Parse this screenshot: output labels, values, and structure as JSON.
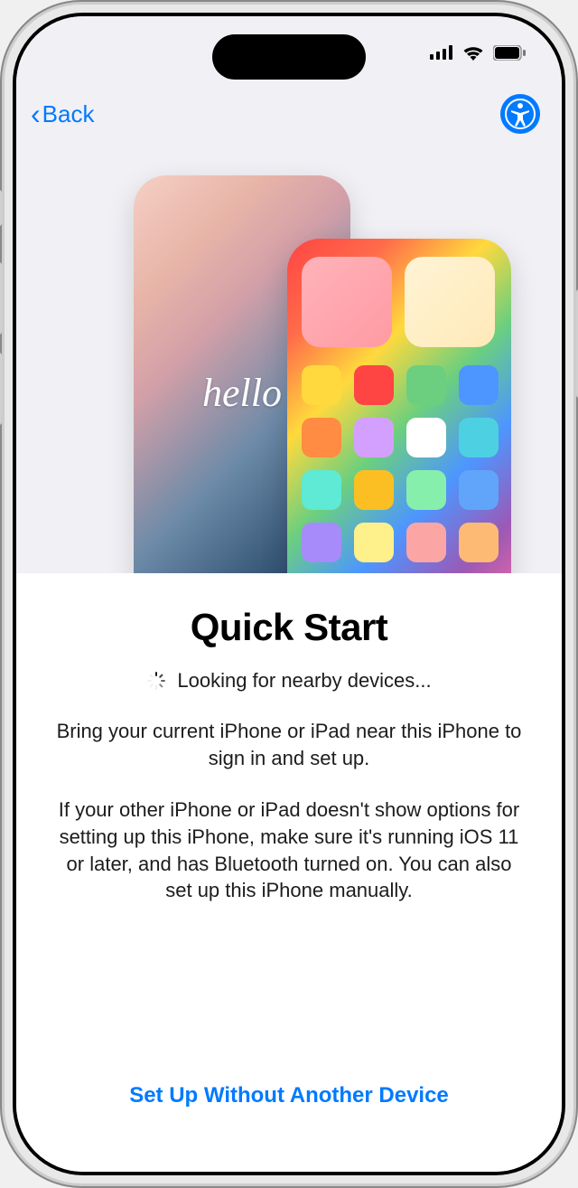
{
  "nav": {
    "back_label": "Back"
  },
  "hero": {
    "hello_text": "hello"
  },
  "content": {
    "title": "Quick Start",
    "status": "Looking for nearby devices...",
    "description_primary": "Bring your current iPhone or iPad near this iPhone to sign in and set up.",
    "description_secondary": "If your other iPhone or iPad doesn't show options for setting up this iPhone, make sure it's running iOS 11 or later, and has Bluetooth turned on. You can also set up this iPhone manually."
  },
  "footer": {
    "alternate_setup": "Set Up Without Another Device"
  },
  "app_icons": [
    {
      "color": "#ffd93d"
    },
    {
      "color": "#ff4444"
    },
    {
      "color": "#6bcf7f"
    },
    {
      "color": "#4d96ff"
    },
    {
      "color": "#ff8c42"
    },
    {
      "color": "#d4a0ff"
    },
    {
      "color": "#ffffff"
    },
    {
      "color": "#4dd0e1"
    },
    {
      "color": "#5eead4"
    },
    {
      "color": "#fbbf24"
    },
    {
      "color": "#86efac"
    },
    {
      "color": "#60a5fa"
    },
    {
      "color": "#a78bfa"
    },
    {
      "color": "#fef08a"
    },
    {
      "color": "#fca5a5"
    },
    {
      "color": "#fdba74"
    }
  ]
}
